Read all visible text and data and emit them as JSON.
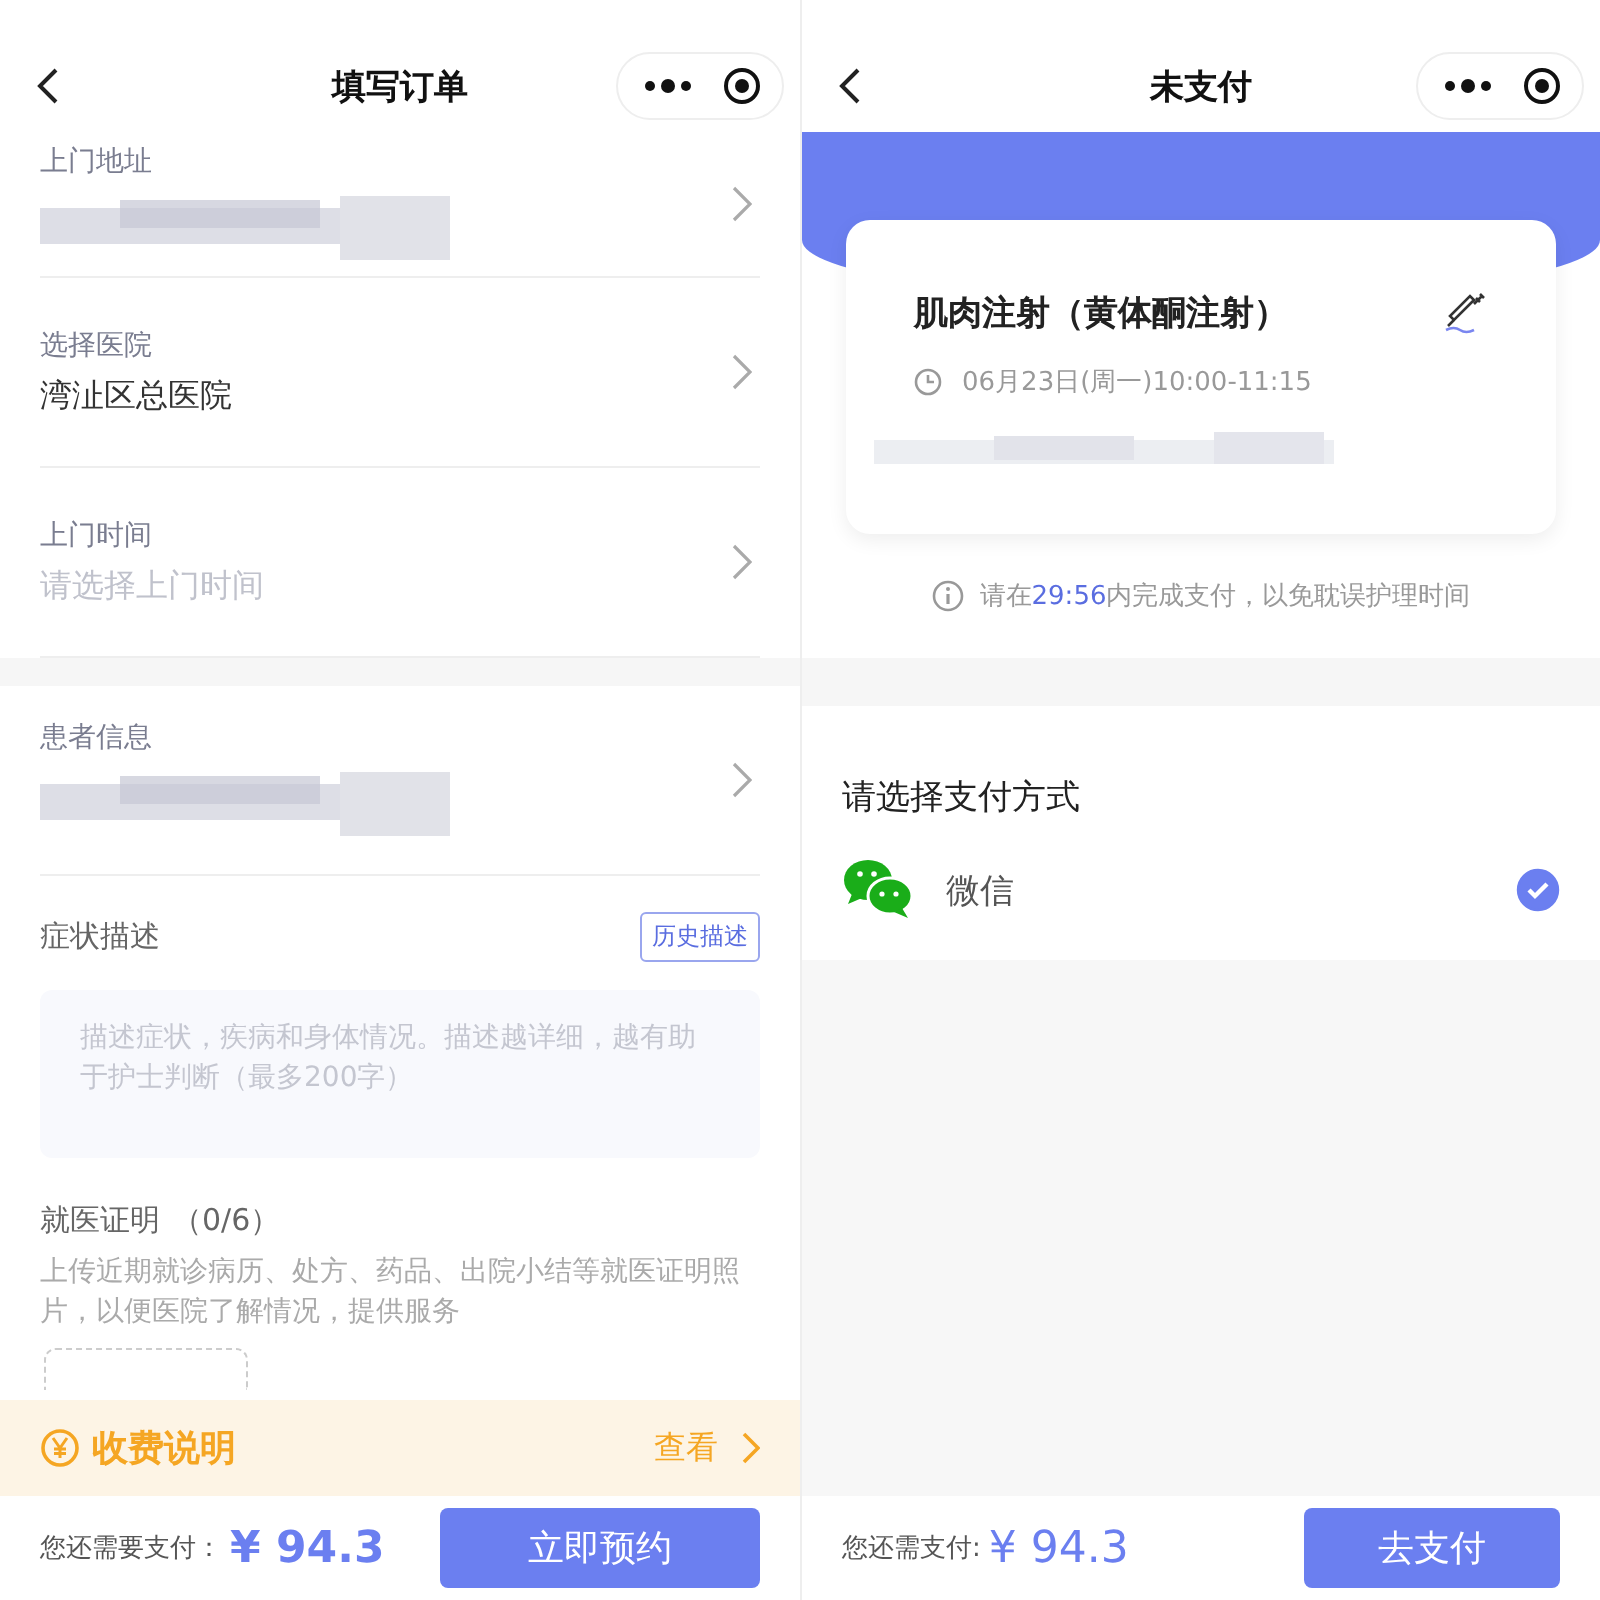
{
  "order_form": {
    "title": "填写订单",
    "fields": [
      {
        "kind": "redacted",
        "label": "上门地址"
      },
      {
        "kind": "value",
        "label": "选择医院",
        "value": "湾沚区总医院"
      },
      {
        "kind": "placeholder",
        "label": "上门时间",
        "placeholder": "请选择上门时间"
      },
      {
        "kind": "redacted",
        "label": "患者信息"
      }
    ],
    "symptom": {
      "label": "症状描述",
      "history_button": "历史描述",
      "placeholder": "描述症状，疾病和身体情况。描述越详细，越有助于护士判断（最多200字）"
    },
    "proof": {
      "label": "就医证明",
      "count": "（0/6）",
      "description": "上传近期就诊病历、处方、药品、出院小结等就医证明照片，以便医院了解情况，提供服务"
    },
    "fee": {
      "label": "收费说明",
      "link": "查看"
    },
    "footer": {
      "label": "您还需要支付：",
      "amount": "¥ 94.3",
      "button": "立即预约"
    }
  },
  "payment": {
    "title": "未支付",
    "service": {
      "title": "肌肉注射（黄体酮注射）",
      "time": "06月23日(周一)10:00-11:15"
    },
    "notice": {
      "before": "请在",
      "countdown": "29:56",
      "after": "内完成支付，以免耽误护理时间"
    },
    "methods_title": "请选择支付方式",
    "methods": [
      {
        "label": "微信",
        "selected": true
      }
    ],
    "footer": {
      "label": "您还需支付:",
      "amount": "¥ 94.3",
      "button": "去支付"
    }
  }
}
